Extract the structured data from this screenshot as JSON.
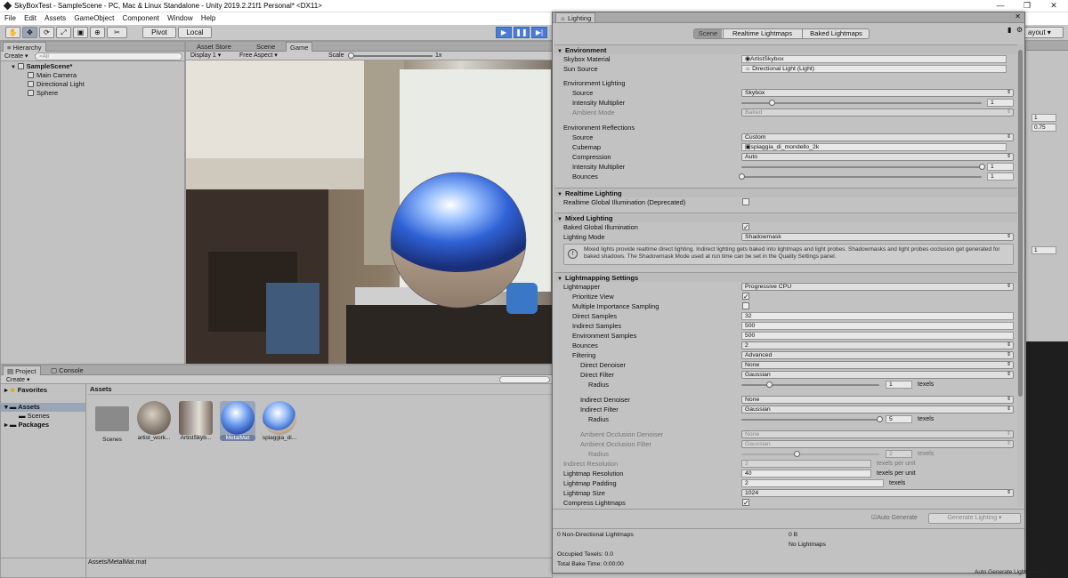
{
  "window": {
    "title": "SkyBoxTest - SampleScene - PC, Mac & Linux Standalone - Unity 2019.2.21f1 Personal* <DX11>",
    "controls": [
      "—",
      "❐",
      "✕"
    ]
  },
  "menu": [
    "File",
    "Edit",
    "Assets",
    "GameObject",
    "Component",
    "Window",
    "Help"
  ],
  "toolbar": {
    "pivot": "Pivot",
    "local": "Local",
    "layout": "ayout"
  },
  "hierarchy": {
    "tab": "Hierarchy",
    "create": "Create",
    "search_placeholder": "All",
    "scene": "SampleScene*",
    "items": [
      "Main Camera",
      "Directional Light",
      "Sphere"
    ]
  },
  "scene_tabs": [
    "Asset Store",
    "Scene",
    "Game"
  ],
  "game_bar": {
    "display": "Display 1",
    "aspect": "Free Aspect",
    "scale_label": "Scale",
    "scale_value": "1x"
  },
  "project": {
    "tabs": [
      "Project",
      "Console"
    ],
    "create": "Create",
    "favorites": "Favorites",
    "assets": "Assets",
    "scenes": "Scenes",
    "packages": "Packages",
    "breadcrumb": "Assets",
    "tiles": [
      "Scenes",
      "artist_work...",
      "ArtistSkyb...",
      "MetalMat",
      "spiaggia_di..."
    ],
    "footer_path": "Assets/MetalMat.mat"
  },
  "inspector_values": {
    "v1": "1",
    "v2": "0.75",
    "v3": "1"
  },
  "lighting": {
    "tab": "Lighting",
    "tabs": [
      "Scene",
      "Realtime Lightmaps",
      "Baked Lightmaps"
    ],
    "environment": {
      "header": "Environment",
      "skybox_material_label": "Skybox Material",
      "skybox_material": "ArtistSkybox",
      "sun_source_label": "Sun Source",
      "sun_source": "Directional Light (Light)",
      "env_lighting_label": "Environment Lighting",
      "source_label": "Source",
      "source": "Skybox",
      "intensity_label": "Intensity Multiplier",
      "intensity": "1",
      "intensity_frac": 0.125,
      "ambient_mode_label": "Ambient Mode",
      "ambient_mode": "Baked",
      "env_reflections_label": "Environment Reflections",
      "refl_source_label": "Source",
      "refl_source": "Custom",
      "cubemap_label": "Cubemap",
      "cubemap": "spiaggia_di_mondello_2k",
      "compression_label": "Compression",
      "compression": "Auto",
      "refl_intensity_label": "Intensity Multiplier",
      "refl_intensity": "1",
      "refl_intensity_frac": 1.0,
      "bounces_label": "Bounces",
      "bounces": "1",
      "bounces_frac": 0.0
    },
    "realtime": {
      "header": "Realtime Lighting",
      "gi_label": "Realtime Global Illumination (Deprecated)",
      "gi_checked": false
    },
    "mixed": {
      "header": "Mixed Lighting",
      "baked_gi_label": "Baked Global Illumination",
      "baked_gi_checked": true,
      "mode_label": "Lighting Mode",
      "mode": "Shadowmask",
      "info": "Mixed lights provide realtime direct lighting. Indirect lighting gets baked into lightmaps and light probes. Shadowmasks and light probes occlusion get generated for baked shadows. The Shadowmask Mode used at run time can be set in the Quality Settings panel."
    },
    "lightmapping": {
      "header": "Lightmapping Settings",
      "lightmapper_label": "Lightmapper",
      "lightmapper": "Progressive CPU",
      "prioritize_label": "Prioritize View",
      "prioritize_checked": true,
      "mis_label": "Multiple Importance Sampling",
      "mis_checked": false,
      "direct_samples_label": "Direct Samples",
      "direct_samples": "32",
      "indirect_samples_label": "Indirect Samples",
      "indirect_samples": "500",
      "env_samples_label": "Environment Samples",
      "env_samples": "500",
      "bounces_label": "Bounces",
      "bounces": "2",
      "filtering_label": "Filtering",
      "filtering": "Advanced",
      "direct_denoiser_label": "Direct Denoiser",
      "direct_denoiser": "None",
      "direct_filter_label": "Direct Filter",
      "direct_filter": "Gaussian",
      "radius_label": "Radius",
      "direct_radius": "1",
      "direct_radius_frac": 0.2,
      "indirect_denoiser_label": "Indirect Denoiser",
      "indirect_denoiser": "None",
      "indirect_filter_label": "Indirect Filter",
      "indirect_filter": "Gaussian",
      "indirect_radius": "5",
      "indirect_radius_frac": 1.0,
      "ao_denoiser_label": "Ambient Occlusion Denoiser",
      "ao_denoiser": "None",
      "ao_filter_label": "Ambient Occlusion Filter",
      "ao_filter": "Gaussian",
      "ao_radius": "2",
      "ao_radius_frac": 0.4,
      "texels": "texels",
      "indirect_res_label": "Indirect Resolution",
      "indirect_res": "2",
      "indirect_res_units": "texels per unit",
      "lightmap_res_label": "Lightmap Resolution",
      "lightmap_res": "40",
      "lightmap_res_units": "texels per unit",
      "padding_label": "Lightmap Padding",
      "padding": "2",
      "padding_units": "texels",
      "size_label": "Lightmap Size",
      "size": "1024",
      "compress_label": "Compress Lightmaps"
    },
    "auto_generate_label": "Auto Generate",
    "generate_label": "Generate Lighting",
    "stats": {
      "non_directional": "0 Non-Directional Lightmaps",
      "bytes": "0 B",
      "no_lightmaps": "No Lightmaps",
      "occupied": "Occupied Texels: 0.0",
      "bake_time": "Total Bake Time: 0:00:00"
    },
    "status": "Auto Generate Lighting On"
  }
}
